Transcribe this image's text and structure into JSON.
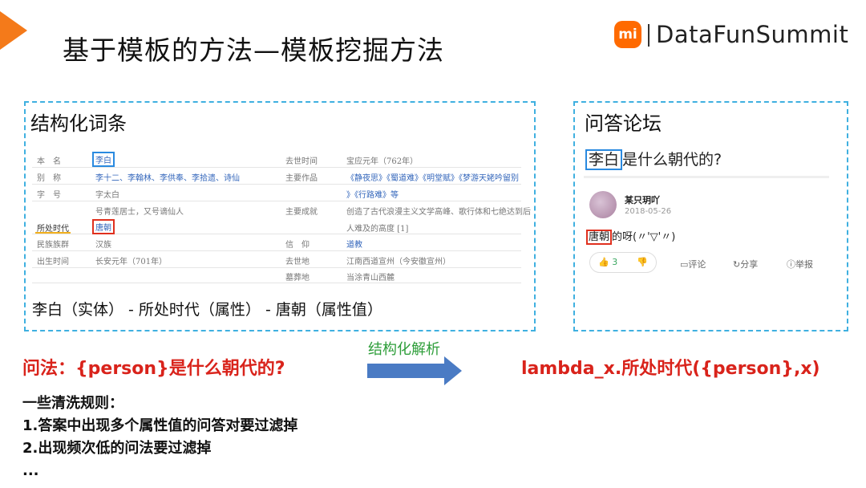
{
  "slide": {
    "title": "基于模板的方法—模板挖掘方法",
    "logo_badge": "mi",
    "logo_text": "DataFunSummit",
    "accent_color": "#f47a1a"
  },
  "left_panel": {
    "title": "结构化词条",
    "rows": [
      {
        "l_label": "本　名",
        "l_value": "李白",
        "r_label": "去世时间",
        "r_value": "宝应元年（762年）"
      },
      {
        "l_label": "别　称",
        "l_value": "李十二、李翰林、李供奉、李拾遗、诗仙",
        "r_label": "主要作品",
        "r_value": "《静夜思》《蜀道难》《明堂赋》《梦游天姥吟留别"
      },
      {
        "l_label": "字　号",
        "l_value": "字太白",
        "r_label": "",
        "r_value": "》《行路难》等"
      },
      {
        "l_label": "",
        "l_value": "号青莲居士，又号谪仙人",
        "r_label": "主要成就",
        "r_value": "创造了古代浪漫主义文学高峰、歌行体和七绝达到后"
      },
      {
        "l_label": "所处时代",
        "l_value": "唐朝",
        "r_label": "",
        "r_value": "人难及的高度 [1]"
      },
      {
        "l_label": "民族族群",
        "l_value": "汉族",
        "r_label": "信　仰",
        "r_value": "道教"
      },
      {
        "l_label": "出生时间",
        "l_value": "长安元年（701年）",
        "r_label": "去世地",
        "r_value": "江南西道宣州（今安徽宣州）"
      },
      {
        "l_label": "",
        "l_value": "",
        "r_label": "墓葬地",
        "r_value": "当涂青山西麓"
      }
    ],
    "triple": "李白（实体） - 所处时代（属性） - 唐朝（属性值）"
  },
  "right_panel": {
    "title": "问答论坛",
    "question_entity": "李白",
    "question_rest": "是什么朝代的?",
    "username": "某只玥吖",
    "date": "2018-05-26",
    "answer_entity": "唐朝",
    "answer_rest": "的呀(〃'▽'〃)",
    "upvotes": "3",
    "comment_label": "评论",
    "share_label": "分享",
    "report_label": "举报"
  },
  "pattern": {
    "question_template": "问法：{person}是什么朝代的?",
    "arrow_label": "结构化解析",
    "lambda": "lambda_x.所处时代({person},x)"
  },
  "rules": {
    "heading": "一些清洗规则：",
    "items": [
      "1.答案中出现多个属性值的问答对要过滤掉",
      "2.出现频次低的问法要过滤掉",
      "..."
    ]
  }
}
